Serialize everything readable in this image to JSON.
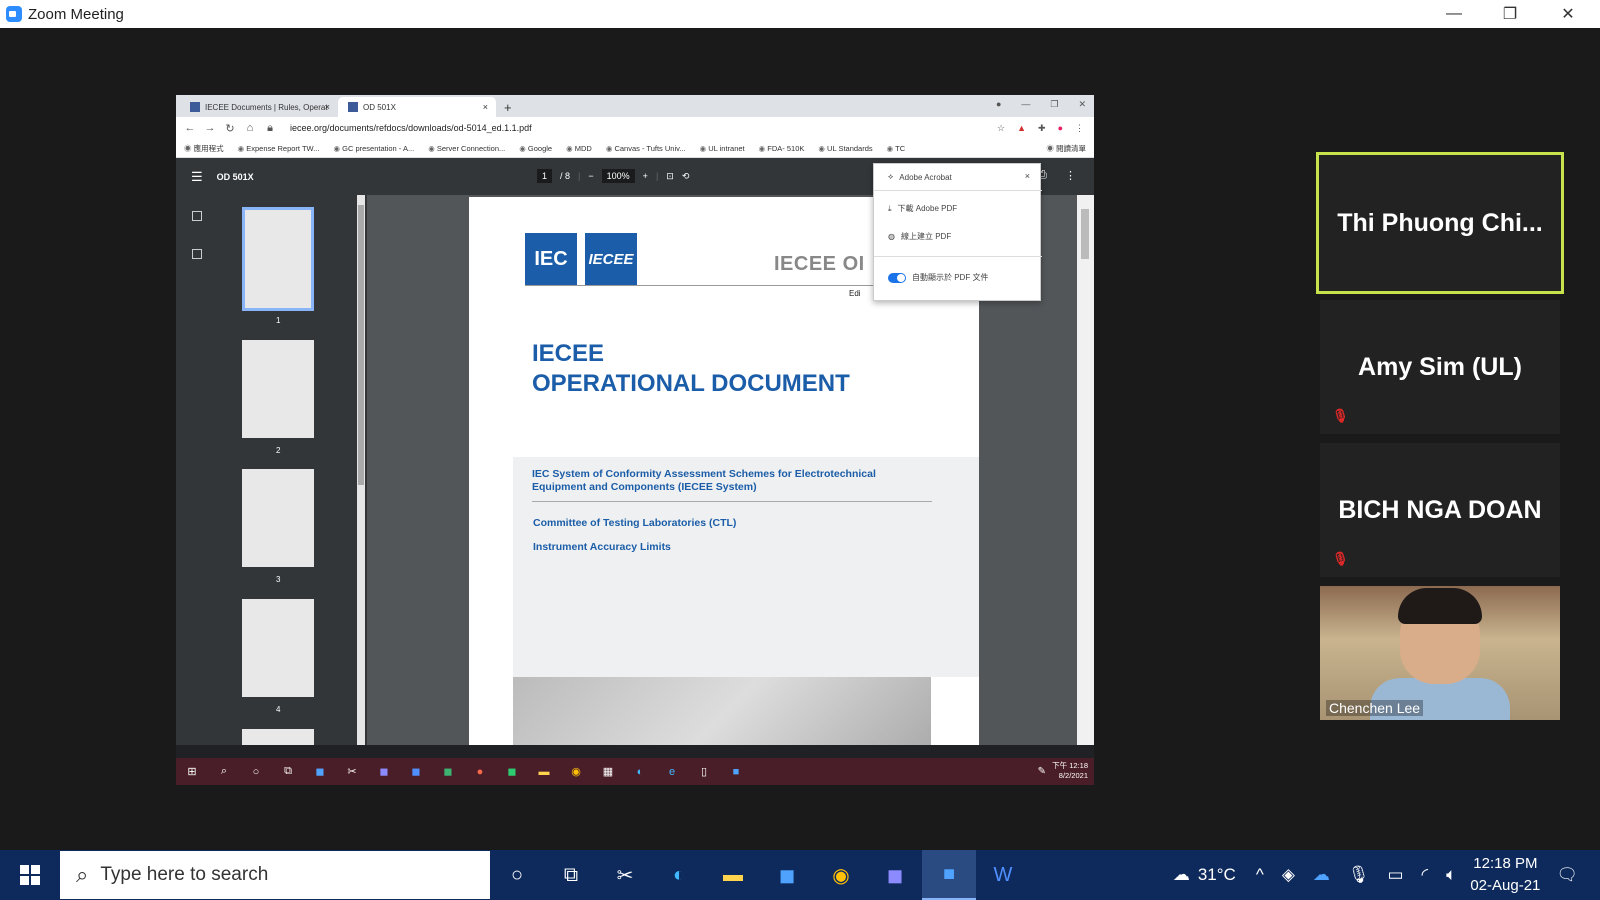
{
  "window": {
    "title": "Zoom Meeting",
    "minimize": "—",
    "restore": "❐",
    "close": "✕"
  },
  "browser": {
    "tabs": [
      {
        "label": "IECEE Documents | Rules, Operat",
        "close": "×"
      },
      {
        "label": "OD 501X",
        "close": "×"
      }
    ],
    "new_tab": "+",
    "url": "iecee.org/documents/refdocs/downloads/od-5014_ed.1.1.pdf",
    "bookmarks": [
      "應用程式",
      "Expense Report TW...",
      "GC presentation - A...",
      "Server Connection...",
      "Google",
      "MDD",
      "Canvas - Tufts Univ...",
      "UL intranet",
      "FDA- 510K",
      "UL Standards",
      "TC",
      "閱讀清單"
    ]
  },
  "pdf": {
    "title": "OD 501X",
    "page_current": "1",
    "page_total": "/  8",
    "zoom": "100%",
    "thumbs": [
      "1",
      "2",
      "3",
      "4"
    ],
    "doc": {
      "logo1": "IEC",
      "logo2": "IECEE",
      "header": "IECEE OI",
      "edi": "Edi",
      "title_line1": "IECEE",
      "title_line2": "OPERATIONAL DOCUMENT",
      "system": "IEC System of Conformity Assessment Schemes for Electrotechnical Equipment and Components (IECEE System)",
      "ctl": "Committee of Testing Laboratories (CTL)",
      "ial": "Instrument Accuracy Limits"
    }
  },
  "acrobat_menu": {
    "title": "Adobe Acrobat",
    "item1": "下載 Adobe PDF",
    "item2": "線上建立 PDF",
    "item3": "自動顯示於 PDF 文件"
  },
  "inner_taskbar": {
    "time": "下午 12:18",
    "date": "8/2/2021"
  },
  "participants": [
    {
      "name": "Thi  Phuong  Chi..."
    },
    {
      "name": "Amy Sim (UL)"
    },
    {
      "name": "BICH NGA DOAN"
    },
    {
      "name": "Chenchen Lee"
    }
  ],
  "taskbar": {
    "search_placeholder": "Type here to search",
    "weather": "31°C",
    "time": "12:18 PM",
    "date": "02-Aug-21"
  }
}
